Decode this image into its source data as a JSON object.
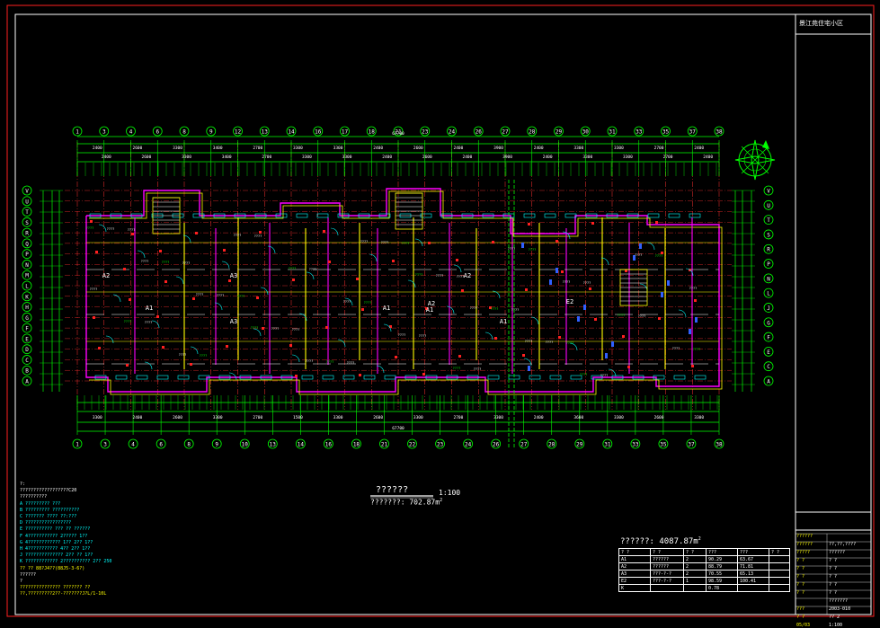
{
  "project_name": "景江苑住宅小区",
  "plan": {
    "title": "??????",
    "scale": "1:100",
    "area_text": "???????: 702.87m",
    "total_area_text": "??????: 4087.87m",
    "sup2": "2"
  },
  "top_axes": [
    "1",
    "3",
    "4",
    "6",
    "8",
    "9",
    "12",
    "13",
    "14",
    "16",
    "17",
    "18",
    "21",
    "23",
    "24",
    "26",
    "27",
    "28",
    "29",
    "30",
    "31",
    "33",
    "35",
    "37",
    "38"
  ],
  "bottom_axes": [
    "1",
    "3",
    "4",
    "6",
    "8",
    "9",
    "10",
    "13",
    "14",
    "16",
    "18",
    "21",
    "22",
    "23",
    "24",
    "26",
    "27",
    "28",
    "29",
    "31",
    "33",
    "35",
    "37",
    "38"
  ],
  "left_axes": [
    "V",
    "U",
    "T",
    "S",
    "R",
    "Q",
    "P",
    "N",
    "M",
    "L",
    "K",
    "H",
    "G",
    "F",
    "E",
    "D",
    "C",
    "B",
    "A"
  ],
  "right_axes": [
    "V",
    "U",
    "T",
    "S",
    "R",
    "P",
    "N",
    "L",
    "J",
    "G",
    "F",
    "E",
    "C",
    "A"
  ],
  "room_labels": [
    "A2",
    "A3",
    "A2",
    "A2",
    "A1",
    "A1",
    "A1",
    "E2",
    "A3",
    "A1"
  ],
  "dimensions_top": [
    "2400",
    "2600",
    "3300",
    "3400",
    "2700",
    "3300",
    "3300",
    "2400",
    "2600",
    "2400",
    "3900",
    "2400",
    "3300",
    "3300",
    "2700",
    "2400"
  ],
  "dimensions_bottom": [
    "3300",
    "2400",
    "2600",
    "3300",
    "2700",
    "1500",
    "3300",
    "2600",
    "3300",
    "2700",
    "3300",
    "2400",
    "3600",
    "3300",
    "2600",
    "3300"
  ],
  "overall_dim": "67700",
  "notes": [
    {
      "text": "?:",
      "color": "#ffffff"
    },
    {
      "text": "??????????????????C20",
      "color": "#ffffff"
    },
    {
      "text": "??????????",
      "color": "#ffffff"
    },
    {
      "text": "A  ?????????  ???",
      "color": "#00ffff"
    },
    {
      "text": "B  ?????????  ??????????",
      "color": "#00ffff"
    },
    {
      "text": "C  ???????   ????  ??:???",
      "color": "#00ffff"
    },
    {
      "text": "D  ?????????????????",
      "color": "#00ffff"
    },
    {
      "text": "E  ??????????  ???  ??  ??????",
      "color": "#00ffff"
    },
    {
      "text": "F  4???????????     2?????  1??",
      "color": "#00ffff"
    },
    {
      "text": "G  4????????????    1??  2??  1??",
      "color": "#00ffff"
    },
    {
      "text": "H  4???????????     4??  2??  1??",
      "color": "#00ffff"
    },
    {
      "text": "J  ??????????????   2??  ??  1??",
      "color": "#00ffff"
    },
    {
      "text": "K  ????????????     2??????????  2?? 250",
      "color": "#00ffff"
    },
    {
      "text": "?? ?? 88?J4??(88J5-3-6?)",
      "color": "#ffff00"
    },
    {
      "text": "??????",
      "color": "#ffffff"
    },
    {
      "text": "?",
      "color": "#ffffff"
    },
    {
      "text": "???????????????  ???????    ??",
      "color": "#ffff00"
    },
    {
      "text": "??,?????????2??-???????J?L/1-10L",
      "color": "#ffff00"
    }
  ],
  "unit_table": {
    "headers": [
      "? ?",
      "? ?",
      "? ?",
      "???",
      "???",
      "? ?"
    ],
    "rows": [
      [
        "A1",
        "??????",
        "2",
        "90.29",
        "63.67",
        ""
      ],
      [
        "A2",
        "??????",
        "2",
        "88.79",
        "71.81",
        ""
      ],
      [
        "A3",
        "???-?-?",
        "2",
        "70.55",
        "65.13",
        ""
      ],
      [
        "E2",
        "???-?-?",
        "1",
        "98.59",
        "100.41",
        ""
      ],
      [
        "K",
        "",
        "",
        "0.78",
        "",
        ""
      ]
    ]
  },
  "title_block": {
    "rows": [
      {
        "label": "??????",
        "value": ""
      },
      {
        "label": "??????",
        "value": "??,??,????"
      },
      {
        "label": "?????",
        "value": "??????"
      },
      {
        "label": "? ?",
        "value": "? ?"
      },
      {
        "label": "? ?",
        "value": "? ?"
      },
      {
        "label": "? ?",
        "value": "? ?"
      },
      {
        "label": "? ?",
        "value": "? ?"
      },
      {
        "label": "? ?",
        "value": "? ?"
      },
      {
        "label": "",
        "value": "???????"
      },
      {
        "label": "???",
        "value": "2003-010"
      },
      {
        "label": "? ?",
        "value": "?? 2"
      },
      {
        "label": "05/03",
        "value": "1:100"
      }
    ]
  }
}
